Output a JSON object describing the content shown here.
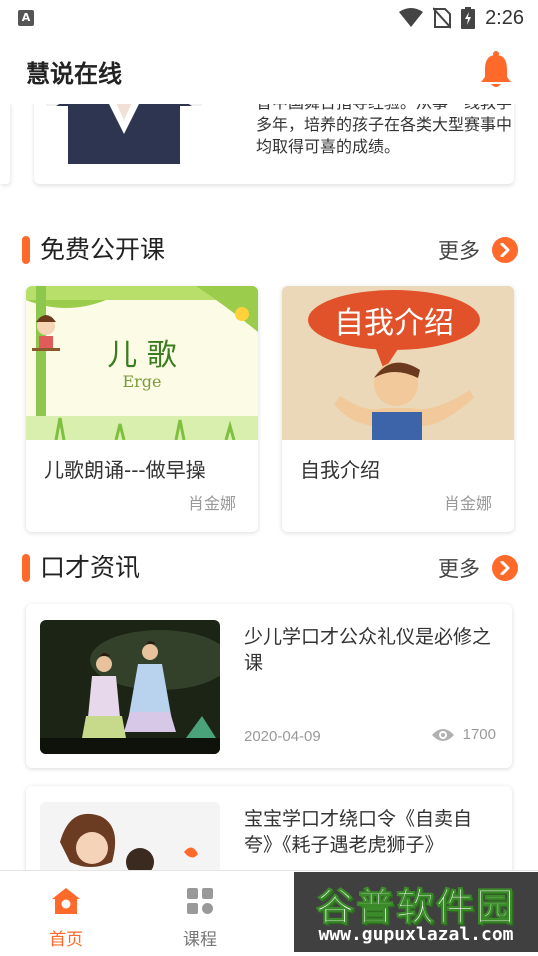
{
  "status_bar": {
    "notification_letter": "A",
    "time": "2:26"
  },
  "header": {
    "title": "慧说在线"
  },
  "teacher": {
    "intro": "曾中国舞台指导经验。从事一线教学多年，培养的孩子在各类大型赛事中均取得可喜的成绩。"
  },
  "free_courses": {
    "title": "免费公开课",
    "more": "更多",
    "items": [
      {
        "name": "儿歌朗诵---做早操",
        "teacher": "肖金娜",
        "thumb_title": "儿  歌",
        "thumb_sub": "Erge"
      },
      {
        "name": "自我介绍",
        "teacher": "肖金娜",
        "thumb_title": "自我介绍"
      }
    ]
  },
  "news": {
    "title": "口才资讯",
    "more": "更多",
    "items": [
      {
        "title": "少儿学口才公众礼仪是必修之课",
        "date": "2020-04-09",
        "views": "1700"
      },
      {
        "title": "宝宝学口才绕口令《自卖自夸》《耗子遇老虎狮子》"
      }
    ]
  },
  "bottom_nav": {
    "home": "首页",
    "course": "课程"
  },
  "watermark": {
    "title": "谷普软件园",
    "url": "www.gupuxlazal.com"
  },
  "colors": {
    "accent": "#ff6a2b"
  }
}
